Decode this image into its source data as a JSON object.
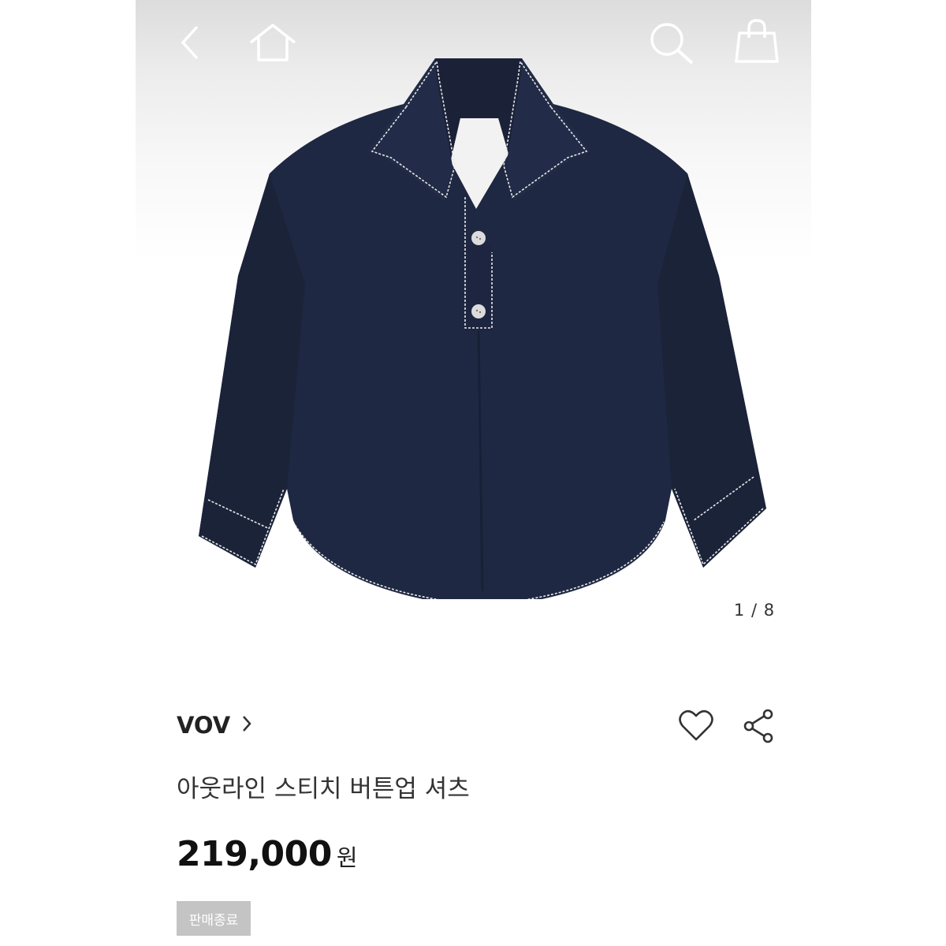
{
  "header": {
    "icons": [
      "back-icon",
      "home-icon",
      "search-icon",
      "shopping-bag-icon"
    ]
  },
  "gallery": {
    "counter": "1 / 8"
  },
  "product": {
    "brand": "VOV",
    "name": "아웃라인 스티치 버튼업 셔츠",
    "price": "219,000",
    "currency": "원",
    "status_badge": "판매종료"
  },
  "colors": {
    "shirt": "#1f2842",
    "stitch": "#e8e8e8",
    "badge": "#c4c4c4",
    "text": "#222222"
  }
}
